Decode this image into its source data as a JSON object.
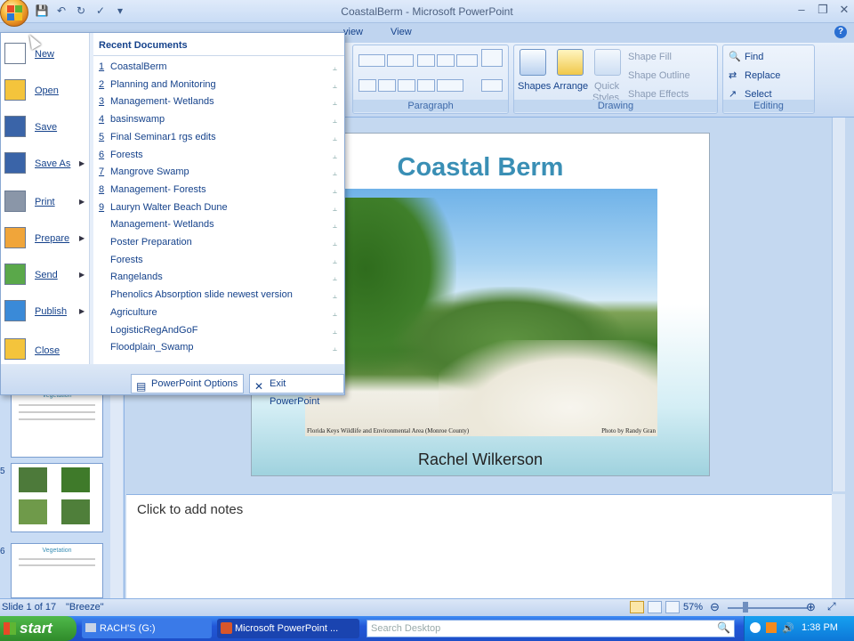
{
  "app": {
    "window_title": "CoastalBerm - Microsoft PowerPoint",
    "tabs_visible": [
      "view",
      "View"
    ]
  },
  "ribbon": {
    "paragraph": {
      "label": "Paragraph"
    },
    "drawing": {
      "label": "Drawing",
      "shapes": "Shapes",
      "arrange": "Arrange",
      "quick_styles_1": "Quick",
      "quick_styles_2": "Styles",
      "shape_fill": "Shape Fill",
      "shape_outline": "Shape Outline",
      "shape_effects": "Shape Effects"
    },
    "editing": {
      "label": "Editing",
      "find": "Find",
      "replace": "Replace",
      "select": "Select"
    }
  },
  "office_menu": {
    "left_items": [
      {
        "label": "New",
        "icon": "new-doc-icon",
        "has_arrow": false
      },
      {
        "label": "Open",
        "icon": "open-folder-icon",
        "has_arrow": false
      },
      {
        "label": "Save",
        "icon": "save-icon",
        "has_arrow": false
      },
      {
        "label": "Save As",
        "icon": "save-as-icon",
        "has_arrow": true
      },
      {
        "label": "Print",
        "icon": "print-icon",
        "has_arrow": true
      },
      {
        "label": "Prepare",
        "icon": "prepare-icon",
        "has_arrow": true
      },
      {
        "label": "Send",
        "icon": "send-icon",
        "has_arrow": true
      },
      {
        "label": "Publish",
        "icon": "publish-icon",
        "has_arrow": true
      },
      {
        "label": "Close",
        "icon": "close-folder-icon",
        "has_arrow": false
      }
    ],
    "recent_title": "Recent Documents",
    "recent_documents": [
      {
        "num": "1",
        "name": "CoastalBerm"
      },
      {
        "num": "2",
        "name": "Planning and Monitoring"
      },
      {
        "num": "3",
        "name": "Management- Wetlands"
      },
      {
        "num": "4",
        "name": "basinswamp"
      },
      {
        "num": "5",
        "name": "Final Seminar1 rgs edits"
      },
      {
        "num": "6",
        "name": "Forests"
      },
      {
        "num": "7",
        "name": "Mangrove Swamp"
      },
      {
        "num": "8",
        "name": "Management- Forests"
      },
      {
        "num": "9",
        "name": "Lauryn Walter Beach Dune"
      },
      {
        "num": "",
        "name": "Management- Wetlands"
      },
      {
        "num": "",
        "name": "Poster Preparation"
      },
      {
        "num": "",
        "name": "Forests"
      },
      {
        "num": "",
        "name": "Rangelands"
      },
      {
        "num": "",
        "name": "Phenolics Absorption slide newest version"
      },
      {
        "num": "",
        "name": "Agriculture"
      },
      {
        "num": "",
        "name": "LogisticRegAndGoF"
      },
      {
        "num": "",
        "name": "Floodplain_Swamp"
      }
    ],
    "options_button": "PowerPoint Options",
    "exit_button": "Exit PowerPoint"
  },
  "thumbnails": [
    {
      "num": "",
      "title": "Vegetation"
    },
    {
      "num": "5",
      "title": ""
    },
    {
      "num": "6",
      "title": "Vegetation"
    }
  ],
  "slide": {
    "title": "Coastal Berm",
    "photo_caption_left": "Florida Keys Wildlife and Environmental Area (Monroe County)",
    "photo_caption_right": "Photo by Randy Gran",
    "author": "Rachel Wilkerson"
  },
  "notes": {
    "placeholder": "Click to add notes"
  },
  "status_bar": {
    "slide_info": "Slide 1 of 17",
    "theme": "\"Breeze\"",
    "zoom": "57%"
  },
  "taskbar": {
    "start": "start",
    "items": [
      {
        "label": "RACH'S (G:)"
      },
      {
        "label": "Microsoft PowerPoint ..."
      }
    ],
    "search_placeholder": "Search Desktop",
    "clock": "1:38 PM"
  },
  "colors": {
    "accent": "#15428b",
    "slide_title": "#3a8fb5",
    "taskbar": "#2157d8",
    "start": "#2f8b2a"
  }
}
